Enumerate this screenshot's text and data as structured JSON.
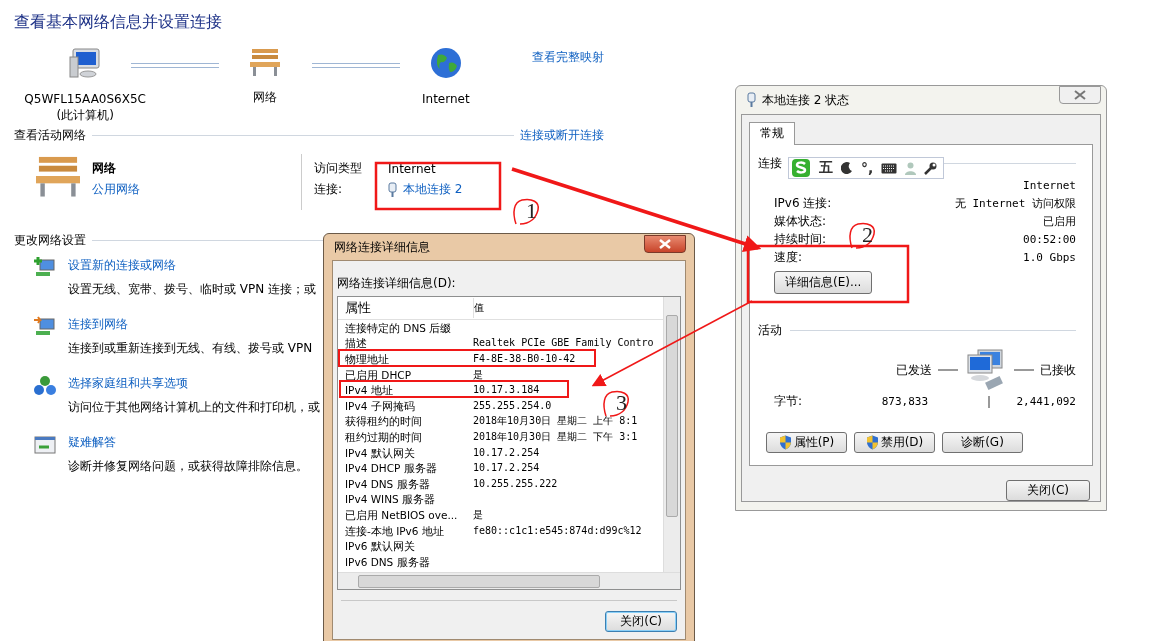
{
  "main": {
    "title": "查看基本网络信息并设置连接",
    "map_link": "查看完整映射",
    "map_nodes": [
      {
        "kind": "computer",
        "label": "Q5WFL15AA0S6X5C",
        "sublabel": "(此计算机)"
      },
      {
        "kind": "network",
        "label": "网络"
      },
      {
        "kind": "internet",
        "label": "Internet"
      }
    ],
    "active_section": {
      "title": "查看活动网络",
      "link": "连接或断开连接"
    },
    "network": {
      "name": "网络",
      "type_link": "公用网络",
      "access_label": "访问类型",
      "access_value": "Internet",
      "connection_label": "连接:",
      "connection_link": "本地连接 2"
    },
    "change_section": {
      "title": "更改网络设置"
    },
    "tasks": [
      {
        "kind": "new_connection",
        "link": "设置新的连接或网络",
        "description": "设置无线、宽带、拨号、临时或 VPN 连接；或"
      },
      {
        "kind": "connect",
        "link": "连接到网络",
        "description": "连接到或重新连接到无线、有线、拨号或 VPN"
      },
      {
        "kind": "homegroup",
        "link": "选择家庭组和共享选项",
        "description": "访问位于其他网络计算机上的文件和打印机，或"
      },
      {
        "kind": "troubleshoot",
        "link": "疑难解答",
        "description": "诊断并修复网络问题，或获得故障排除信息。"
      }
    ]
  },
  "details_dialog": {
    "title": "网络连接详细信息",
    "list_label": "网络连接详细信息(D):",
    "columns": [
      "属性",
      "值"
    ],
    "rows": [
      {
        "property": "连接特定的 DNS 后缀"
      },
      {
        "property": "描述",
        "value": "Realtek PCIe GBE Family Contro"
      },
      {
        "property": "物理地址",
        "value": "F4-8E-38-B0-10-42"
      },
      {
        "property": "已启用 DHCP",
        "value": "是"
      },
      {
        "property": "IPv4 地址",
        "value": "10.17.3.184"
      },
      {
        "property": "IPv4 子网掩码",
        "value": "255.255.254.0"
      },
      {
        "property": "获得租约的时间",
        "value": "2018年10月30日 星期二 上午 8:1"
      },
      {
        "property": "租约过期的时间",
        "value": "2018年10月30日 星期二 下午 3:1"
      },
      {
        "property": "IPv4 默认网关",
        "value": "10.17.2.254"
      },
      {
        "property": "IPv4 DHCP 服务器",
        "value": "10.17.2.254"
      },
      {
        "property": "IPv4 DNS 服务器",
        "value": "10.255.255.222"
      },
      {
        "property": "IPv4 WINS 服务器"
      },
      {
        "property": "已启用 NetBIOS ove...",
        "value": "是"
      },
      {
        "property": "连接-本地 IPv6 地址",
        "value": "fe80::c1c1:e545:874d:d99c%12"
      },
      {
        "property": "IPv6 默认网关"
      },
      {
        "property": "IPv6 DNS 服务器"
      }
    ],
    "close_button": "关闭(C)"
  },
  "status_dialog": {
    "title": "本地连接 2 状态",
    "tabs": [
      {
        "label": "常规",
        "selected": true
      }
    ],
    "connection_section": "连接",
    "rows": [
      {
        "value": "Internet"
      },
      {
        "label": "IPv6 连接:",
        "value": "无 Internet 访问权限"
      },
      {
        "label": "媒体状态:",
        "value": "已启用"
      },
      {
        "label": "持续时间:",
        "value": "00:52:00"
      },
      {
        "label": "速度:",
        "value": "1.0 Gbps"
      }
    ],
    "details_button": "详细信息(E)...",
    "activity_section": "活动",
    "sent_label": "已发送",
    "received_label": "已接收",
    "bytes_label": "字节:",
    "bytes_sent": "873,833",
    "bytes_received": "2,441,092",
    "buttons": [
      {
        "label": "属性(P)",
        "shield": true
      },
      {
        "label": "禁用(D)",
        "shield": true
      },
      {
        "label": "诊断(G)",
        "shield": false
      }
    ],
    "close_button": "关闭(C)"
  },
  "ime_toolbar": {
    "mode": "五",
    "punctuation": "°,"
  },
  "annotation_numbers": [
    "1",
    "2",
    "3"
  ]
}
